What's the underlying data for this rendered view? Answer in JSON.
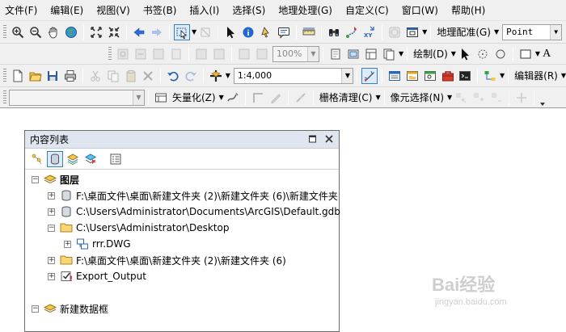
{
  "menu": [
    "文件(F)",
    "编辑(E)",
    "视图(V)",
    "书签(B)",
    "插入(I)",
    "选择(S)",
    "地理处理(G)",
    "自定义(C)",
    "窗口(W)",
    "帮助(H)"
  ],
  "toolbar1": {
    "georef_label": "地理配准(G)",
    "point_value": "Point"
  },
  "toolbar2": {
    "zoom_value": "100%",
    "draw_label": "绘制(D)"
  },
  "toolbar3": {
    "scale_value": "1:4,000",
    "editor_label": "编辑器(R)"
  },
  "toolbar4": {
    "vectorize_label": "矢量化(Z)",
    "raster_cleanup_label": "栅格清理(C)",
    "cell_select_label": "像元选择(N)"
  },
  "toc": {
    "title": "内容列表",
    "rows": [
      {
        "label": "图层",
        "bold": true
      },
      {
        "label": "F:\\桌面文件\\桌面\\新建文件夹 (2)\\新建文件夹 (6)\\新建文件夹"
      },
      {
        "label": "C:\\Users\\Administrator\\Documents\\ArcGIS\\Default.gdb"
      },
      {
        "label": "C:\\Users\\Administrator\\Desktop"
      },
      {
        "label": "rrr.DWG"
      },
      {
        "label": "F:\\桌面文件\\桌面\\新建文件夹 (2)\\新建文件夹 (6)"
      },
      {
        "label": "Export_Output"
      },
      {
        "label": "新建数据框",
        "bold": false
      }
    ]
  },
  "watermark": {
    "brand": "Bai经验",
    "url": "jingyan.baidu.com"
  },
  "colors": {
    "menu_bg": "#f0f0f0",
    "toc_title_bg": "#dfe6ef",
    "active_blue": "#3c7fb1"
  }
}
